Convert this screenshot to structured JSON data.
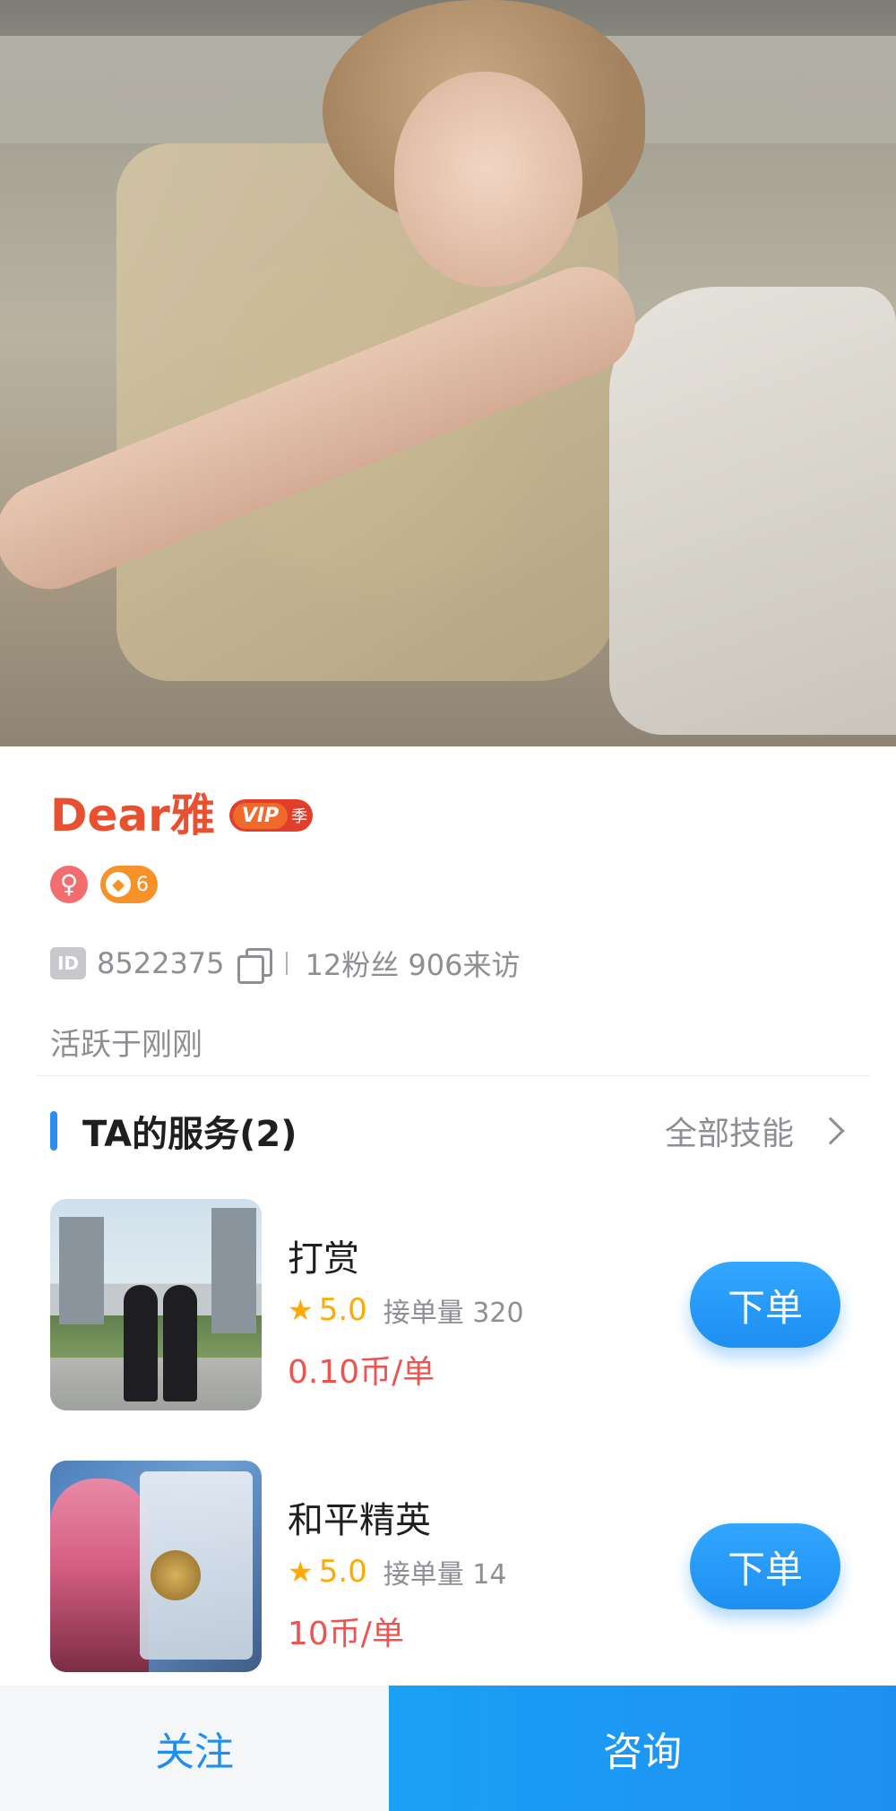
{
  "profile": {
    "name": "Dear雅",
    "vip_label": "VIP",
    "vip_season": "季",
    "gender_symbol": "♀",
    "level": "6",
    "id": "8522375",
    "stats": "12粉丝 906来访",
    "active_status": "活跃于刚刚"
  },
  "services": {
    "title": "TA的服务(2)",
    "all_skills_label": "全部技能",
    "items": [
      {
        "name": "打赏",
        "rating": "5.0",
        "orders_label": "接单量 320",
        "price": "0.10币/单",
        "button_label": "下单"
      },
      {
        "name": "和平精英",
        "rating": "5.0",
        "orders_label": "接单量 14",
        "price": "10币/单",
        "button_label": "下单"
      }
    ]
  },
  "bottom_bar": {
    "follow_label": "关注",
    "consult_label": "咨询"
  },
  "colors": {
    "name": "#e8502f",
    "accent_blue": "#1e8ff2",
    "price_red": "#ef5350",
    "star_gold": "#ffaa00"
  },
  "icons": [
    "gender-female-icon",
    "level-icon",
    "id-icon",
    "copy-icon",
    "chevron-right-icon",
    "star-icon"
  ]
}
